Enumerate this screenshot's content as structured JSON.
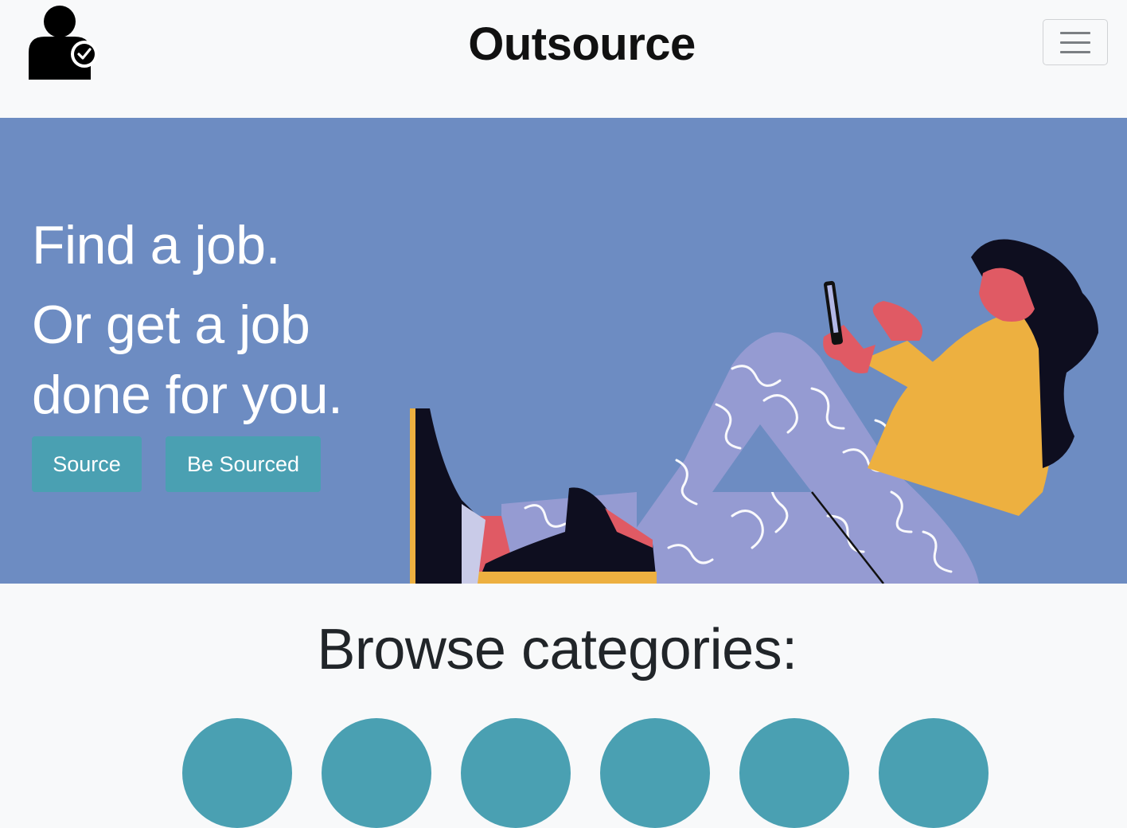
{
  "navbar": {
    "brand": "Outsource",
    "logo_icon": "person-check-icon",
    "menu_icon": "hamburger-menu-icon"
  },
  "hero": {
    "line1": "Find a job.",
    "line2": "Or get a job",
    "line3": "done for you.",
    "source_label": "Source",
    "be_sourced_label": "Be Sourced",
    "illustration": "woman-reclining-with-phone-illustration"
  },
  "browse": {
    "title": "Browse categories:"
  },
  "colors": {
    "hero_bg": "#6d8cc2",
    "button": "#4aa0b2",
    "page_bg": "#f8f9fa"
  }
}
